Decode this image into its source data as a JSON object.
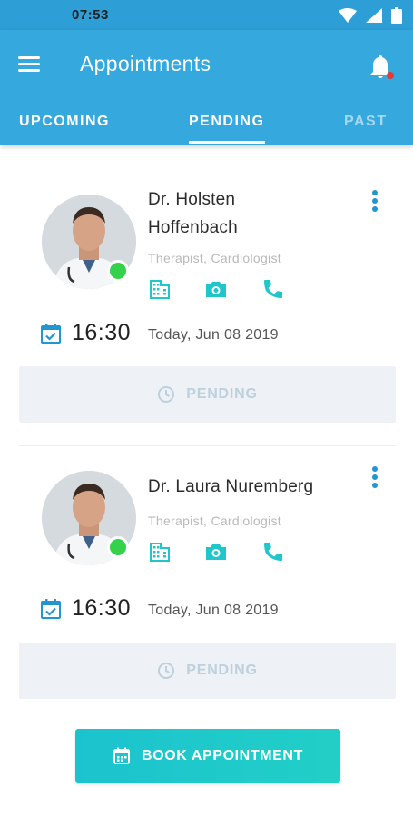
{
  "status_bar": {
    "time": "07:53"
  },
  "app_bar": {
    "title": "Appointments"
  },
  "tabs": [
    {
      "label": "UPCOMING",
      "active": false
    },
    {
      "label": "PENDING",
      "active": true
    },
    {
      "label": "PAST",
      "active": false
    }
  ],
  "appointments": [
    {
      "doctor": "Dr. Holsten Hoffenbach",
      "doctor_line1": "Dr. Holsten",
      "doctor_line2": "Hoffenbach",
      "specialty": "Therapist, Cardiologist",
      "online": true,
      "time": "16:30",
      "date": "Today, Jun 08 2019",
      "status": "PENDING"
    },
    {
      "doctor": "Dr. Laura Nuremberg",
      "specialty": "Therapist, Cardiologist",
      "online": true,
      "time": "16:30",
      "date": "Today, Jun 08 2019",
      "status": "PENDING"
    }
  ],
  "book_button": {
    "label": "BOOK APPOINTMENT"
  },
  "colors": {
    "status_bar": "#2e9ed6",
    "app_bar": "#35a8de",
    "accent_teal": "#1fc7cb",
    "online": "#34d14a",
    "notification_dot": "#e53935",
    "pending_bg": "#eef1f5",
    "pending_text": "#bcd0dd"
  },
  "icons": [
    "wifi-icon",
    "signal-icon",
    "battery-icon",
    "menu-icon",
    "bell-icon",
    "building-icon",
    "camera-icon",
    "phone-icon",
    "more-vert-icon",
    "calendar-check-icon",
    "clock-icon",
    "calendar-icon"
  ]
}
